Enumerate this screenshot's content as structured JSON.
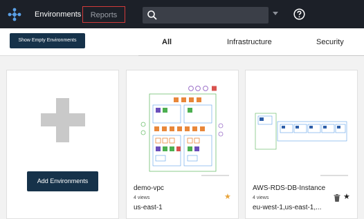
{
  "header": {
    "nav": {
      "environments_label": "Environments",
      "reports_label": "Reports"
    },
    "search": {
      "placeholder": ""
    }
  },
  "toolbar": {
    "show_empty_label": "Show Empty Environments"
  },
  "tabs": [
    {
      "label": "All",
      "active": true
    },
    {
      "label": "Infrastructure",
      "active": false
    },
    {
      "label": "Security",
      "active": false
    }
  ],
  "add_card": {
    "button_label": "Add Environments"
  },
  "environments": [
    {
      "title": "demo-vpc",
      "views": "4 views",
      "region": "us-east-1",
      "starred": true,
      "star_color": "#e8a33a"
    },
    {
      "title": "AWS-RDS-DB-Instance",
      "views": "4 views",
      "region": "eu-west-1,us-east-1,...",
      "starred": true,
      "star_color": "#222222"
    }
  ],
  "colors": {
    "topbar": "#1c2028",
    "primary_button": "#16324a",
    "reports_outline": "#d23a3a"
  }
}
